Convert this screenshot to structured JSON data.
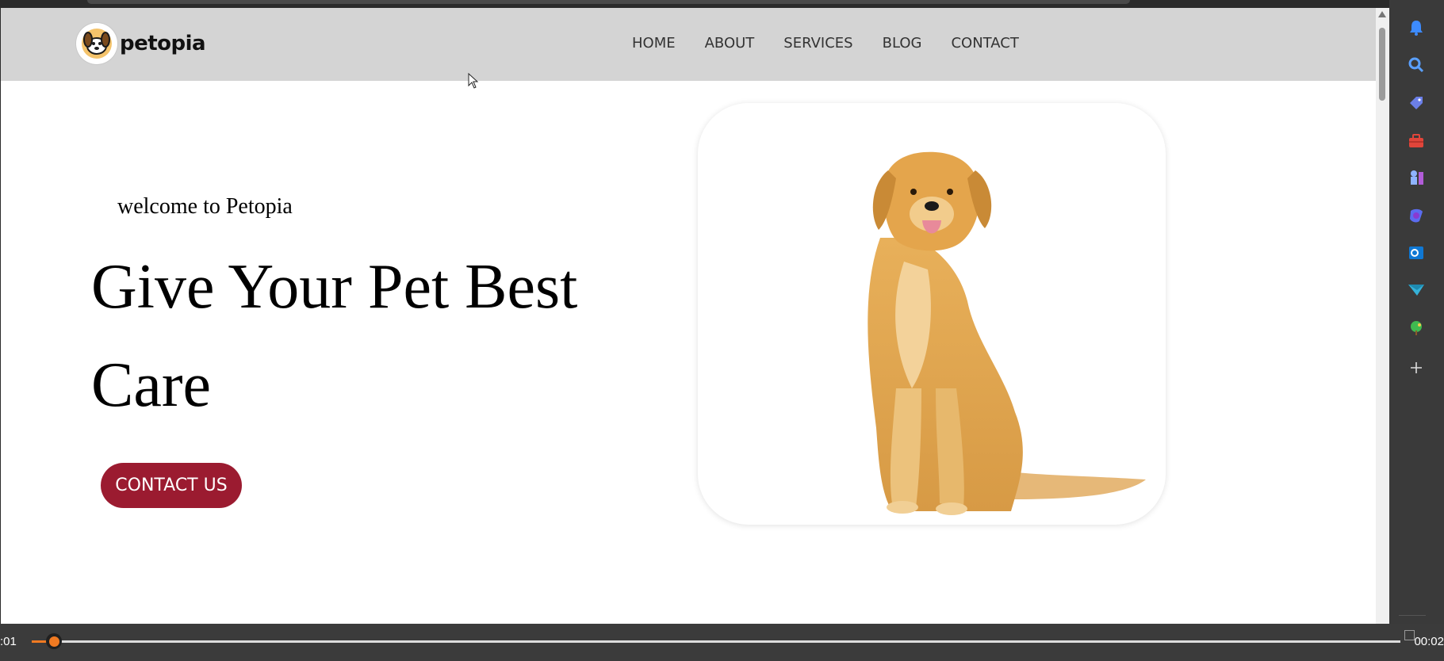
{
  "site": {
    "brand": "petopia",
    "nav": [
      "HOME",
      "ABOUT",
      "SERVICES",
      "BLOG",
      "CONTACT"
    ]
  },
  "hero": {
    "welcome": "welcome to Petopia",
    "headline": "Give Your Pet Best Care",
    "cta": "CONTACT US",
    "image_subject": "golden retriever sitting"
  },
  "sidebar_icons": [
    "bell-icon",
    "search-icon",
    "tag-icon",
    "briefcase-icon",
    "chess-icon",
    "copilot-icon",
    "outlook-icon",
    "send-icon",
    "tree-icon",
    "add-icon"
  ],
  "player": {
    "time_elapsed": ":01",
    "time_total": "00:02",
    "progress": 0.014
  },
  "colors": {
    "accent": "#9b1b30",
    "nav_bg": "#d4d4d4",
    "player_accent": "#f07a22"
  }
}
